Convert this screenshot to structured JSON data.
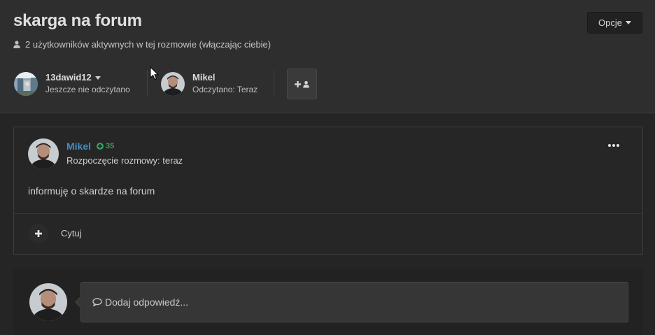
{
  "header": {
    "title": "skarga na forum",
    "active_users": "2 użytkowników aktywnych w tej rozmowie (włączając ciebie)",
    "options_label": "Opcje"
  },
  "participants": [
    {
      "name": "13dawid12",
      "status": "Jeszcze nie odczytano"
    },
    {
      "name": "Mikel",
      "status": "Odczytano: Teraz"
    }
  ],
  "post": {
    "author": "Mikel",
    "reputation": "35",
    "date": "Rozpoczęcie rozmowy: teraz",
    "body": "informuję o skardze na forum",
    "quote_label": "Cytuj"
  },
  "reply": {
    "placeholder": "Dodaj odpowiedź..."
  },
  "colors": {
    "author": "#3f8fc6",
    "reputation": "#35a25a",
    "background": "#252525"
  }
}
